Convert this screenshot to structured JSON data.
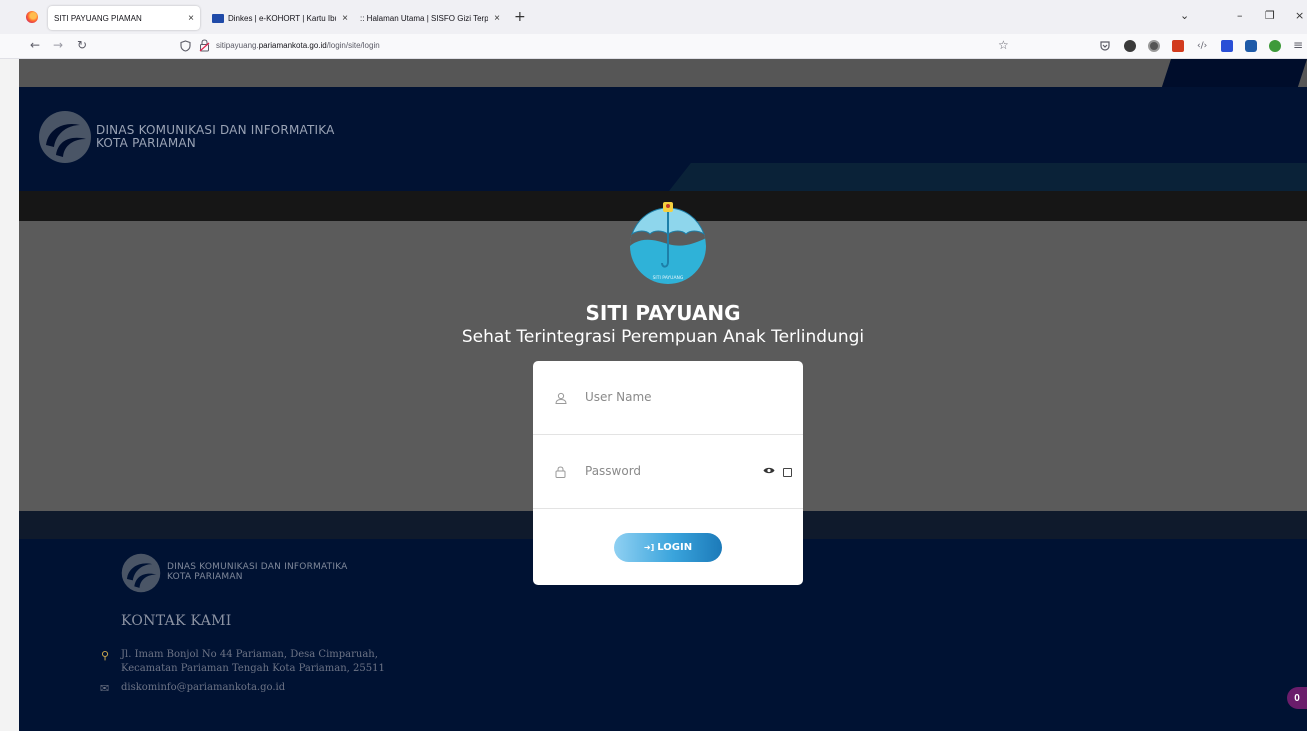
{
  "browser": {
    "tabs": [
      {
        "label": "SITI PAYUANG PIAMAN",
        "close": "×"
      },
      {
        "label": "Dinkes | e-KOHORT | Kartu Ibu",
        "close": "×"
      },
      {
        "label": ":: Halaman Utama | SISFO Gizi Terpa",
        "close": "×"
      }
    ],
    "new_tab": "+",
    "window_controls": {
      "list": "⌄",
      "minimize": "–",
      "restore": "❐",
      "close": "×"
    },
    "nav": {
      "back": "←",
      "forward": "→",
      "reload": "↻",
      "star": "☆"
    },
    "url": {
      "prefix": "sitipayuang.",
      "domain": "pariamankota.go.id",
      "path": "/login/site/login"
    }
  },
  "header": {
    "brand_line1": "DINAS KOMUNIKASI DAN INFORMATIKA",
    "brand_line2": "KOTA PARIAMAN"
  },
  "app": {
    "logo_caption": "SITI PAYUANG",
    "title": "SITI PAYUANG",
    "subtitle": "Sehat Terintegrasi Perempuan Anak Terlindungi"
  },
  "login": {
    "username_placeholder": "User Name",
    "password_placeholder": "Password",
    "button_label": "LOGIN",
    "button_icon": "➜]"
  },
  "footer": {
    "brand_line1": "DINAS KOMUNIKASI DAN INFORMATIKA",
    "brand_line2": "KOTA PARIAMAN",
    "contact_heading": "KONTAK KAMI",
    "address_line1": "Jl. Imam Bonjol No 44 Pariaman, Desa Cimparuah,",
    "address_line2": "Kecamatan Pariaman Tengah Kota Pariaman, 25511",
    "email": "diskominfo@pariamankota.go.id"
  },
  "badge": {
    "count": "0"
  },
  "colors": {
    "page_dark": "#000d2b",
    "band_grey": "#5b5b5b",
    "button_start": "#8fd0f2",
    "button_end": "#1c7ab9",
    "logo_cyan": "#2fb2d8",
    "badge": "#6a1d6b"
  }
}
